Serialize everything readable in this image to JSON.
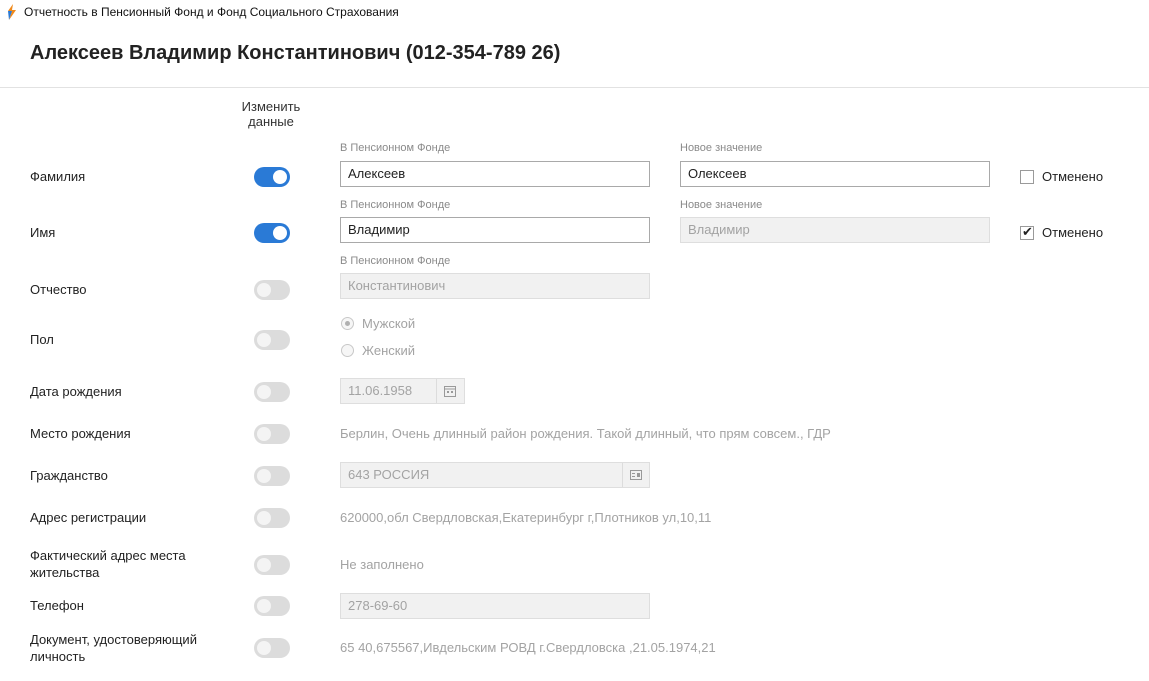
{
  "window": {
    "title": "Отчетность в Пенсионный Фонд и Фонд Социального Страхования"
  },
  "person": {
    "heading": "Алексеев Владимир Константинович (012-354-789 26)"
  },
  "columns": {
    "change_data": "Изменить данные",
    "in_pf": "В Пенсионном Фонде",
    "new_value": "Новое значение",
    "cancelled": "Отменено"
  },
  "rows": {
    "surname": {
      "label": "Фамилия",
      "toggle_on": true,
      "pf_value": "Алексеев",
      "new_value": "Олексеев",
      "cancelled": false
    },
    "name": {
      "label": "Имя",
      "toggle_on": true,
      "pf_value": "Владимир",
      "new_placeholder": "Владимир",
      "cancelled": true
    },
    "patronymic": {
      "label": "Отчество",
      "toggle_on": false,
      "pf_value": "Константинович"
    },
    "gender": {
      "label": "Пол",
      "toggle_on": false,
      "options": [
        "Мужской",
        "Женский"
      ],
      "selected": "Мужской"
    },
    "birth_date": {
      "label": "Дата рождения",
      "toggle_on": false,
      "value": "11.06.1958"
    },
    "birth_place": {
      "label": "Место рождения",
      "toggle_on": false,
      "value": "Берлин, Очень длинный район рождения. Такой длинный, что прям совсем., ГДР"
    },
    "citizenship": {
      "label": "Гражданство",
      "toggle_on": false,
      "value": "643 РОССИЯ"
    },
    "reg_address": {
      "label": "Адрес регистрации",
      "toggle_on": false,
      "value": "620000,обл Свердловская,Екатеринбург г,Плотников ул,10,11"
    },
    "actual_address": {
      "label": "Фактический адрес места жительства",
      "toggle_on": false,
      "value": "Не заполнено"
    },
    "phone": {
      "label": "Телефон",
      "toggle_on": false,
      "value": "278-69-60"
    },
    "id_doc": {
      "label": "Документ, удостоверяющий личность",
      "toggle_on": false,
      "value": "65 40,675567,Ивдельским РОВД г.Свердловска ,21.05.1974,21"
    }
  },
  "colors": {
    "accent": "#2a7ad6",
    "toggle_off": "#dcdcdc",
    "disabled_text": "#a3a3a3"
  },
  "icons": {
    "app": "app-logo-icon",
    "calendar": "calendar-icon",
    "list": "list-picker-icon",
    "check": "checkmark-icon"
  }
}
